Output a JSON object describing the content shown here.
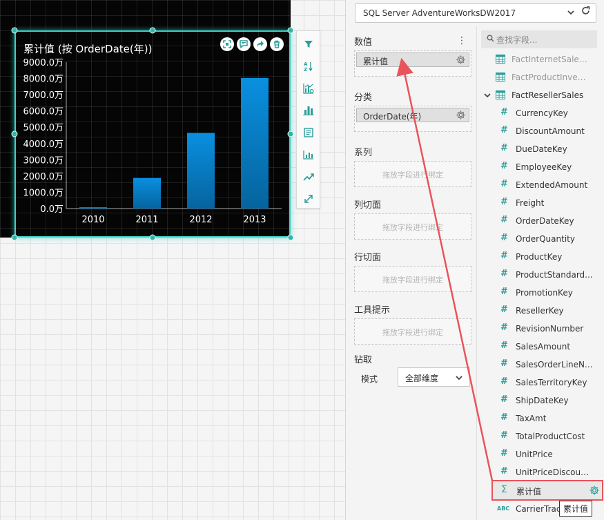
{
  "chart": {
    "title": "累计值 (按 OrderDate(年))"
  },
  "chart_data": {
    "type": "bar",
    "categories": [
      "2010",
      "2011",
      "2012",
      "2013"
    ],
    "values": [
      80,
      1880,
      4650,
      8030
    ],
    "y_tick_labels": [
      "0.0万",
      "1000.0万",
      "2000.0万",
      "3000.0万",
      "4000.0万",
      "5000.0万",
      "6000.0万",
      "7000.0万",
      "8000.0万",
      "9000.0万"
    ],
    "ylim": [
      0,
      9000
    ],
    "y_unit": "万",
    "bar_color": "#0a8fe0",
    "grid": false
  },
  "widget_actions": [
    {
      "icon": "expand-icon"
    },
    {
      "icon": "comment-icon"
    },
    {
      "icon": "share-icon"
    },
    {
      "icon": "delete-icon"
    }
  ],
  "side_toolbar": [
    {
      "icon": "filter-icon"
    },
    {
      "icon": "sort-icon"
    },
    {
      "icon": "analysis-icon"
    },
    {
      "icon": "bar-chart-icon"
    },
    {
      "icon": "form-icon"
    },
    {
      "icon": "chart-type-icon"
    },
    {
      "icon": "trend-icon"
    },
    {
      "icon": "resize-icon"
    }
  ],
  "datasource": {
    "name": "SQL Server AdventureWorksDW2017"
  },
  "binding": {
    "values_label": "数值",
    "values_field": "累计值",
    "category_label": "分类",
    "category_field": "OrderDate(年)",
    "series_label": "系列",
    "column_slice_label": "列切面",
    "row_slice_label": "行切面",
    "tooltip_label": "工具提示",
    "drop_placeholder": "拖放字段进行绑定",
    "drill_label": "钻取",
    "mode_label": "模式",
    "mode_value": "全部维度"
  },
  "fields": {
    "search_placeholder": "查找字段...",
    "tables": [
      {
        "name": "FactInternetSales..."
      },
      {
        "name": "FactProductInvent..."
      },
      {
        "name": "FactResellerSales"
      }
    ],
    "items": [
      "CurrencyKey",
      "DiscountAmount",
      "DueDateKey",
      "EmployeeKey",
      "ExtendedAmount",
      "Freight",
      "OrderDateKey",
      "OrderQuantity",
      "ProductKey",
      "ProductStandard...",
      "PromotionKey",
      "ResellerKey",
      "RevisionNumber",
      "SalesAmount",
      "SalesOrderLineN...",
      "SalesTerritoryKey",
      "ShipDateKey",
      "TaxAmt",
      "TotalProductCost",
      "UnitPrice",
      "UnitPriceDiscoun..."
    ],
    "calc_field": "累计值",
    "last_field": "CarrierTrac",
    "tooltip": "累计值"
  },
  "colors": {
    "accent": "#2a9d99",
    "selection": "#3fd1c6",
    "highlight_border": "#e9535a",
    "arrow": "#e9535a"
  }
}
